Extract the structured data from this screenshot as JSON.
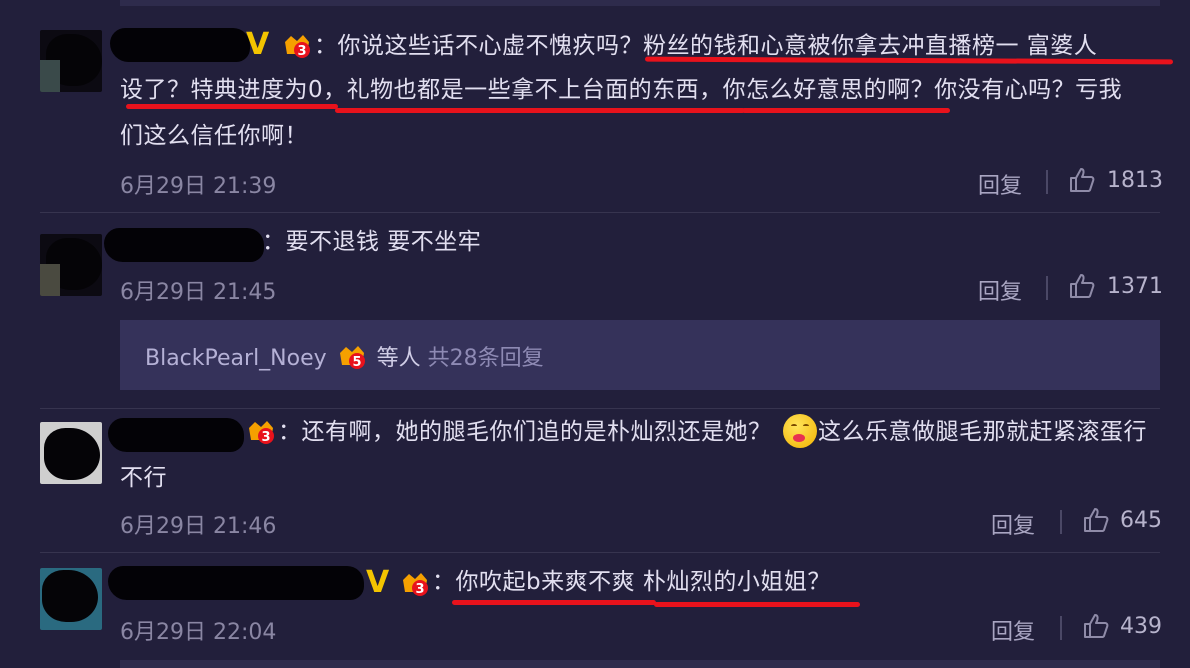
{
  "comments": [
    {
      "text_line1": "：你说这些话不心虚不愧疚吗？粉丝的钱和心意被你拿去冲直播榜一 富婆人",
      "text_line2": "设了？特典进度为0，礼物也都是一些拿不上台面的东西，你怎么好意思的啊？你没有心吗？亏我",
      "text_line3": "们这么信任你啊！",
      "date": "6月29日 21:39",
      "reply": "回复",
      "likes": "1813"
    },
    {
      "text_line1": "：要不退钱 要不坐牢",
      "date": "6月29日 21:45",
      "reply": "回复",
      "likes": "1371"
    },
    {
      "text_line1a": "：还有啊，她的腿毛你们追的是朴灿烈还是她？",
      "text_line1b": "这么乐意做腿毛那就赶紧滚蛋行",
      "text_line2": "不行",
      "date": "6月29日 21:46",
      "reply": "回复",
      "likes": "645"
    },
    {
      "text_line1": "：你吹起b来爽不爽 朴灿烈的小姐姐？",
      "date": "6月29日 22:04",
      "reply": "回复",
      "likes": "439"
    }
  ],
  "more_replies": {
    "user": "BlackPearl_Noey",
    "suffix": "等人",
    "count": "共28条回复"
  },
  "badges": {
    "v": "V",
    "level3": "3",
    "level5": "5"
  },
  "colors": {
    "background": "#221f3b",
    "underline": "#e8121c",
    "verified": "#f3c400"
  }
}
